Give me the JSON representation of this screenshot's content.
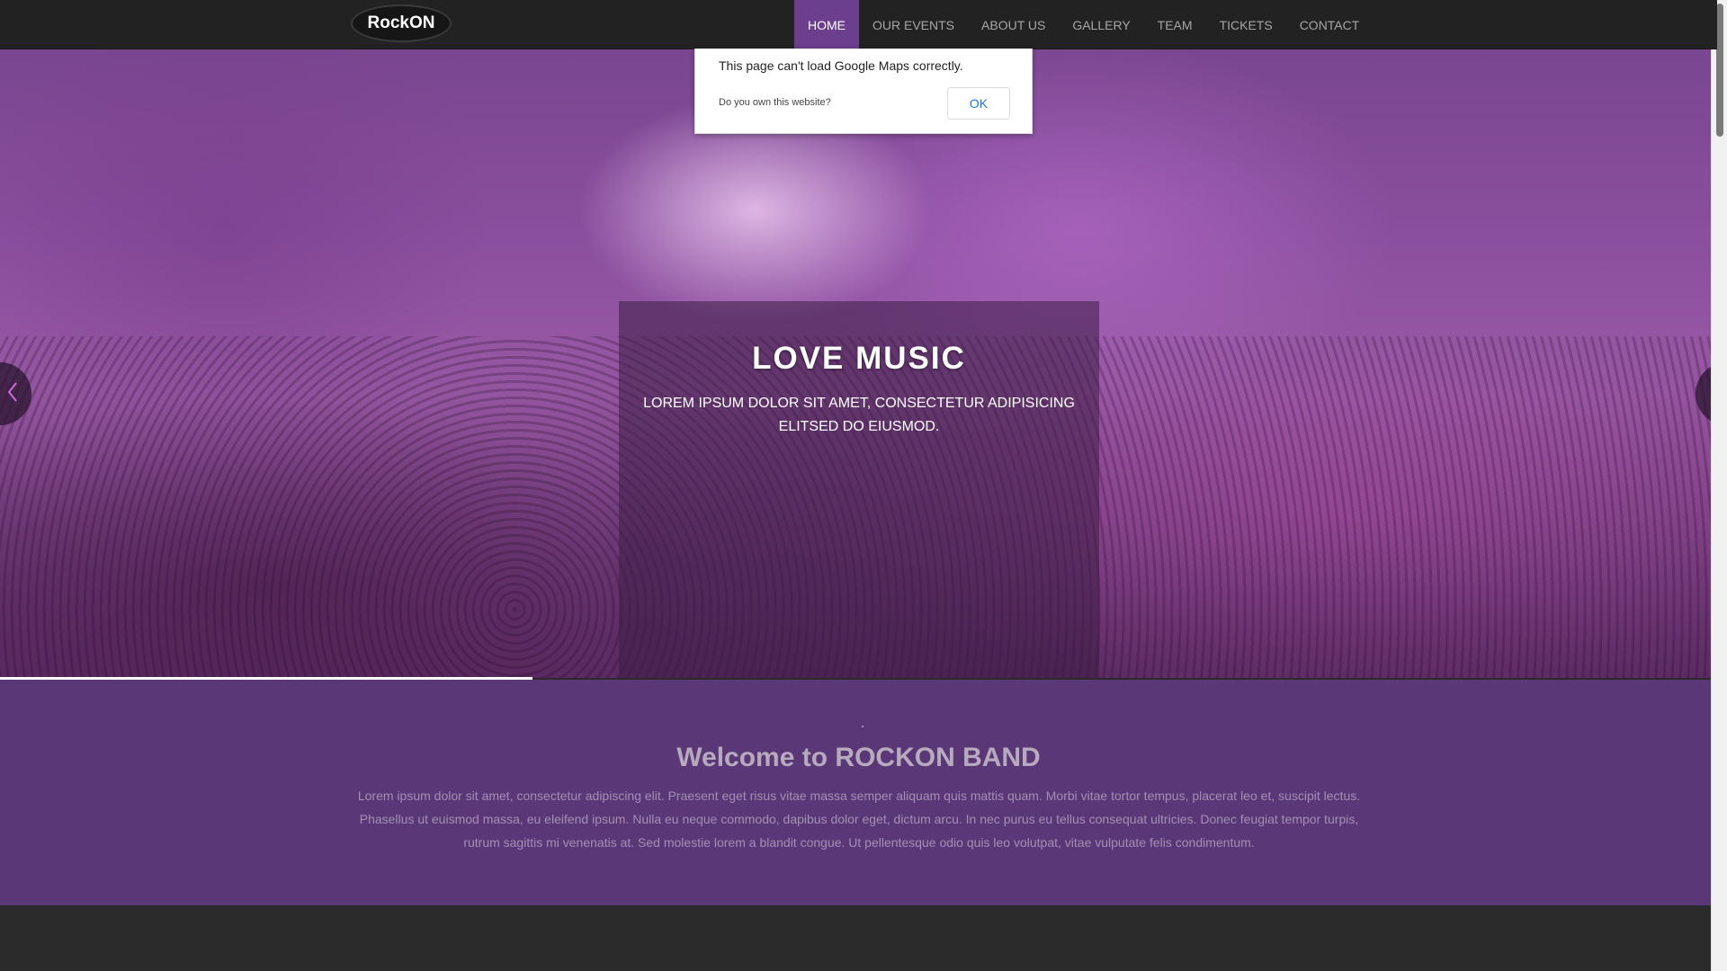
{
  "brand": {
    "logo_text": "RockON"
  },
  "nav": {
    "items": [
      {
        "label": "HOME",
        "active": true
      },
      {
        "label": "OUR EVENTS",
        "active": false
      },
      {
        "label": "ABOUT US",
        "active": false
      },
      {
        "label": "GALLERY",
        "active": false
      },
      {
        "label": "TEAM",
        "active": false
      },
      {
        "label": "TICKETS",
        "active": false
      },
      {
        "label": "CONTACT",
        "active": false
      }
    ]
  },
  "maps_dialog": {
    "message": "This page can't load Google Maps correctly.",
    "own_website": "Do you own this website?",
    "ok_label": "OK"
  },
  "hero": {
    "title": "LOVE MUSIC",
    "text": "LOREM IPSUM DOLOR SIT AMET, CONSECTETUR ADIPISICING ELITSED DO EIUSMOD.",
    "prev_icon": "chevron-left-icon",
    "next_icon": "chevron-right-icon",
    "slide_progress": 0.31
  },
  "welcome": {
    "title": "Welcome to ROCKON BAND",
    "text": "Lorem ipsum dolor sit amet, consectetur adipiscing elit. Praesent eget risus vitae massa semper aliquam quis mattis quam. Morbi vitae tortor tempus, placerat leo et, suscipit lectus. Phasellus ut euismod massa, eu eleifend ipsum. Nulla eu neque commodo, dapibus dolor eget, dictum arcu. In nec purus eu tellus consequat ultricies. Donec feugiat tempor turpis, rutrum sagittis mi venenatis at. Sed molestie lorem a blandit congue. Ut pellentesque odio quis leo volutpat, vitae vulputate felis condimentum."
  },
  "colors": {
    "nav_background": "#222222",
    "nav_active": "#6b3e8e",
    "welcome_background": "#5a3877",
    "hero_tint": "#8a4f9e"
  }
}
